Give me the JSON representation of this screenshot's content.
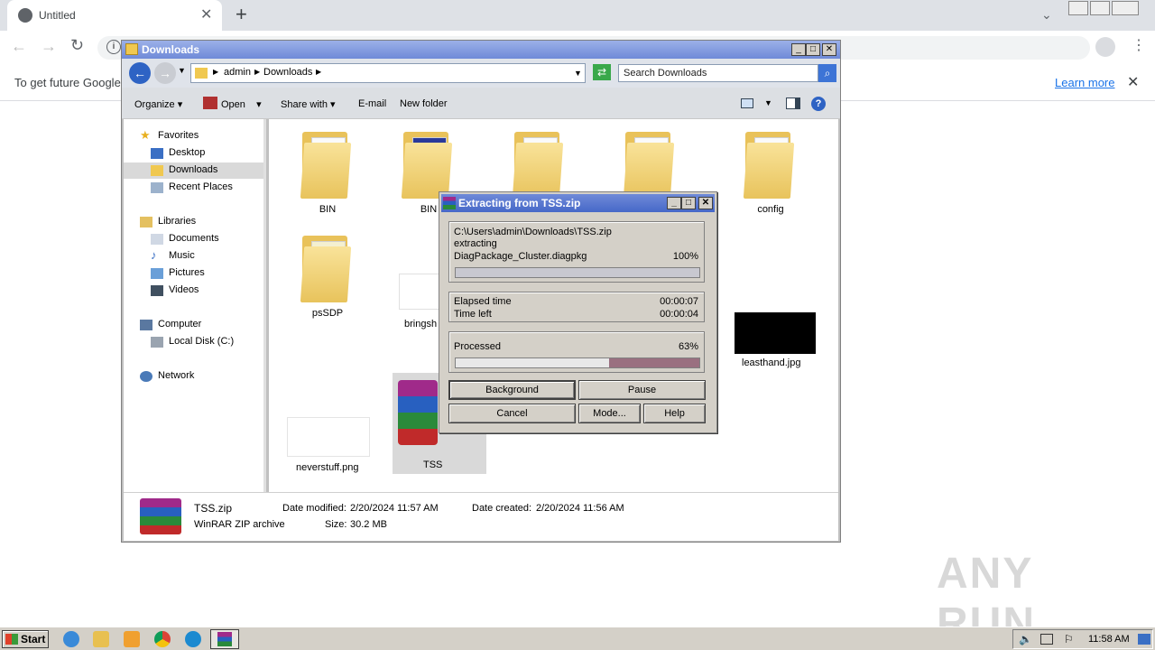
{
  "chrome": {
    "tab_title": "Untitled",
    "new_tab": "+",
    "infobar_text": "To get future Google",
    "infobar_link": "Learn more"
  },
  "explorer": {
    "title": "Downloads",
    "breadcrumb": [
      "admin",
      "Downloads"
    ],
    "search_placeholder": "Search Downloads",
    "toolbar": [
      "Organize",
      "Open",
      "Share with",
      "E-mail",
      "New folder"
    ],
    "nav": {
      "favorites": "Favorites",
      "desktop": "Desktop",
      "downloads": "Downloads",
      "recent": "Recent Places",
      "libraries": "Libraries",
      "documents": "Documents",
      "music": "Music",
      "pictures": "Pictures",
      "videos": "Videos",
      "computer": "Computer",
      "local_disk": "Local Disk (C:)",
      "network": "Network"
    },
    "items": {
      "bin1": "BIN",
      "bin2": "BIN",
      "config": "config",
      "pssdp": "psSDP",
      "bringsh": "bringsh",
      "leasthand": "leasthand.jpg",
      "neverstuff": "neverstuff.png",
      "tss": "TSS"
    },
    "details": {
      "name": "TSS.zip",
      "type": "WinRAR ZIP archive",
      "modified_label": "Date modified:",
      "modified": "2/20/2024 11:57 AM",
      "created_label": "Date created:",
      "created": "2/20/2024 11:56 AM",
      "size_label": "Size:",
      "size": "30.2 MB"
    }
  },
  "rar": {
    "title": "Extracting from TSS.zip",
    "path": "C:\\Users\\admin\\Downloads\\TSS.zip",
    "action": "extracting",
    "file": "DiagPackage_Cluster.diagpkg",
    "file_percent": "100%",
    "file_progress": 1.0,
    "elapsed_label": "Elapsed time",
    "elapsed": "00:00:07",
    "left_label": "Time left",
    "left": "00:00:04",
    "processed_label": "Processed",
    "processed_percent": "63%",
    "processed_progress": 0.63,
    "buttons": {
      "background": "Background",
      "pause": "Pause",
      "cancel": "Cancel",
      "mode": "Mode...",
      "help": "Help"
    }
  },
  "taskbar": {
    "start": "Start",
    "clock": "11:58 AM"
  },
  "watermark": "ANY RUN"
}
